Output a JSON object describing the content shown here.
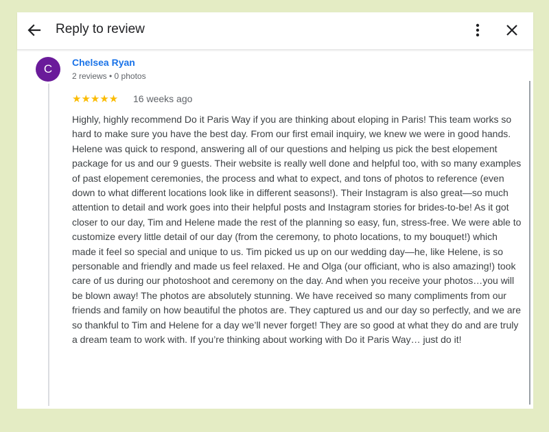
{
  "header": {
    "title": "Reply to review",
    "back_icon": "arrow-back-icon",
    "more_icon": "more-vert-icon",
    "close_icon": "close-icon"
  },
  "review": {
    "avatar_letter": "C",
    "avatar_color": "#6a1b9a",
    "reviewer_name": "Chelsea Ryan",
    "reviewer_meta": "2 reviews • 0 photos",
    "rating": 5,
    "stars": "★★★★★",
    "star_color": "#fbbc04",
    "time_ago": "16 weeks ago",
    "text": "Highly, highly recommend Do it Paris Way if you are thinking about eloping in Paris! This team works so hard to make sure you have the best day. From our first email inquiry, we knew we were in good hands. Helene was quick to respond, answering all of our questions and helping us pick the best elopement package for us and our 9 guests. Their website is really well done and helpful too, with so many examples of past elopement ceremonies, the process and what to expect, and tons of photos to reference (even down to what different locations look like in different seasons!). Their Instagram is also great—so much attention to detail and work goes into their helpful posts and Instagram stories for brides-to-be! As it got closer to our day, Tim and Helene made the rest of the planning so easy, fun, stress-free. We were able to customize every little detail of our day (from the ceremony, to photo locations, to my bouquet!) which made it feel so special and unique to us. Tim picked us up on our wedding day—he, like Helene, is so personable and friendly and made us feel relaxed. He and Olga (our officiant, who is also amazing!) took care of us during our photoshoot and ceremony on the day. And when you receive your photos…you will be blown away! The photos are absolutely stunning. We have received so many compliments from our friends and family on how beautiful the photos are. They captured us and our day so perfectly, and we are so thankful to Tim and Helene for a day we’ll never forget! They are so good at what they do and are truly a dream team to work with. If you’re thinking about working with Do it Paris Way… just do it!"
  }
}
